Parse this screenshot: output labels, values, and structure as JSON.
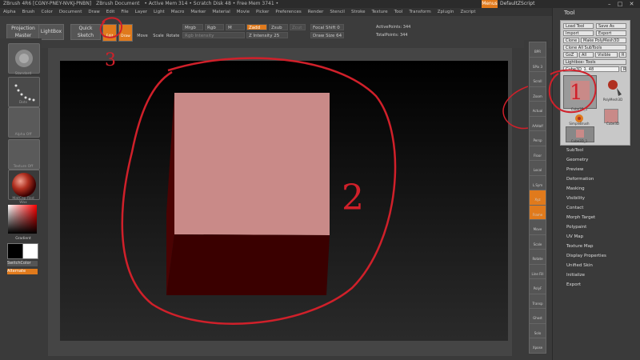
{
  "titlebar": {
    "app": "ZBrush 4R6 [CGNY-PNEY-NVKJ-PNBN]",
    "doc": "ZBrush Document",
    "mem": "• Active Mem 314 • Scratch Disk 48 • Free Mem 3741 •",
    "menu_button": "Menus",
    "script": "DefaultZScript"
  },
  "menubar": [
    "Alpha",
    "Brush",
    "Color",
    "Document",
    "Draw",
    "Edit",
    "File",
    "Layer",
    "Light",
    "Macro",
    "Marker",
    "Material",
    "Movie",
    "Picker",
    "Preferences",
    "Render",
    "Stencil",
    "Stroke",
    "Texture",
    "Tool",
    "Transform",
    "Zplugin",
    "Zscript"
  ],
  "shelf": {
    "projection_master": "Projection Master",
    "lightbox": "LightBox",
    "quick_sketch": "Quick Sketch",
    "edit": "Edit",
    "draw": "Draw",
    "move": "Move",
    "scale": "Scale",
    "rotate": "Rotate",
    "mrgb": "Mrgb",
    "rgb": "Rgb",
    "m": "M",
    "zadd": "Zadd",
    "zsub": "Zsub",
    "zcut": "Zcut",
    "rgb_intensity": "Rgb Intensity",
    "z_intensity": "Z Intensity 25",
    "focal_shift": "Focal Shift 0",
    "draw_size": "Draw Size 64",
    "active_points": "ActivePoints: 344",
    "total_points": "TotalPoints: 344"
  },
  "lefttray": {
    "brush": "Standard",
    "stroke": "Dots",
    "alpha": "Alpha Off",
    "texture": "Texture Off",
    "material": "MatCap Red Wax",
    "gradient": "Gradient",
    "switch_color": "SwitchColor",
    "alternate": "Alternate"
  },
  "rightshelf": [
    "BPR",
    "SPix 3",
    "Scroll",
    "Zoom",
    "Actual",
    "AAHalf",
    "Persp",
    "Floor",
    "Local",
    "L.Sym",
    "Xyz",
    "Frame",
    "Move",
    "Scale",
    "Rotate",
    "Line Fill",
    "PolyF",
    "Transp",
    "Ghost",
    "Solo",
    "Xpose"
  ],
  "tool": {
    "title": "Tool",
    "load_tool": "Load Tool",
    "save_as": "Save As",
    "import": "Import",
    "export": "Export",
    "clone": "Clone",
    "make_polymesh": "Make PolyMesh3D",
    "clone_all": "Clone All SubTools",
    "goz": "GoZ",
    "all": "All",
    "visible": "Visible",
    "r": "R",
    "lightbox_tools": "Lightbox› Tools",
    "current_tool": "Cube3D_1. 48",
    "thumb_labels": [
      "Cube3D_1",
      "PolyMesh3D",
      "SimpleBrush",
      "Cube3D",
      "Cube3D_1"
    ],
    "sections": [
      "SubTool",
      "Geometry",
      "Preview",
      "Deformation",
      "Masking",
      "Visibility",
      "Contact",
      "Morph Target",
      "Polypaint",
      "UV Map",
      "Texture Map",
      "Display Properties",
      "Unified Skin",
      "Initialize",
      "Export"
    ]
  },
  "annotations": {
    "one": "1",
    "two": "2",
    "three": "3"
  },
  "colors": {
    "accent": "#e07a1c",
    "annotation": "#d0202a",
    "cube_top": "#c98a88",
    "cube_left": "#4a0303",
    "cube_front": "#3a0000"
  }
}
